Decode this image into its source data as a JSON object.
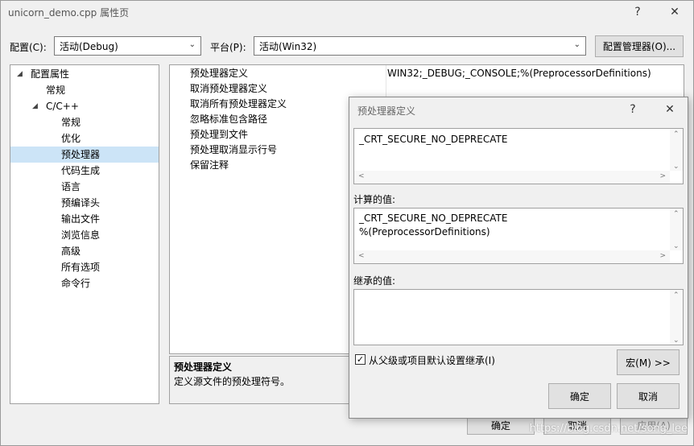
{
  "window": {
    "title": "unicorn_demo.cpp 属性页",
    "help_glyph": "?",
    "close_glyph": "✕"
  },
  "toolbar": {
    "config_label": "配置(C):",
    "config_value": "活动(Debug)",
    "platform_label": "平台(P):",
    "platform_value": "活动(Win32)",
    "config_manager_button": "配置管理器(O)..."
  },
  "tree": {
    "items": [
      {
        "label": "配置属性"
      },
      {
        "label": "常规"
      },
      {
        "label": "C/C++"
      },
      {
        "label": "常规"
      },
      {
        "label": "优化"
      },
      {
        "label": "预处理器"
      },
      {
        "label": "代码生成"
      },
      {
        "label": "语言"
      },
      {
        "label": "预编译头"
      },
      {
        "label": "输出文件"
      },
      {
        "label": "浏览信息"
      },
      {
        "label": "高级"
      },
      {
        "label": "所有选项"
      },
      {
        "label": "命令行"
      }
    ],
    "selected_index": 5
  },
  "grid": {
    "rows": [
      {
        "name": "预处理器定义",
        "value": "WIN32;_DEBUG;_CONSOLE;%(PreprocessorDefinitions)"
      },
      {
        "name": "取消预处理器定义",
        "value": ""
      },
      {
        "name": "取消所有预处理器定义",
        "value": ""
      },
      {
        "name": "忽略标准包含路径",
        "value": ""
      },
      {
        "name": "预处理到文件",
        "value": ""
      },
      {
        "name": "预处理取消显示行号",
        "value": ""
      },
      {
        "name": "保留注释",
        "value": ""
      }
    ]
  },
  "description": {
    "title": "预处理器定义",
    "text": "定义源文件的预处理符号。"
  },
  "bottom_buttons": {
    "ok": "确定",
    "cancel": "取消",
    "apply": "应用(A)"
  },
  "dialog": {
    "title": "预处理器定义",
    "help_glyph": "?",
    "close_glyph": "✕",
    "input_value": "_CRT_SECURE_NO_DEPRECATE",
    "computed_label": "计算的值:",
    "computed_line1": "_CRT_SECURE_NO_DEPRECATE",
    "computed_line2": "%(PreprocessorDefinitions)",
    "inherited_label": "继承的值:",
    "inherit_checkbox_label": "从父级或项目默认设置继承(I)",
    "inherit_checked_glyph": "✓",
    "macro_button": "宏(M) >>",
    "ok": "确定",
    "cancel": "取消"
  },
  "watermark": "https://blog.csdn.net/song_lee"
}
